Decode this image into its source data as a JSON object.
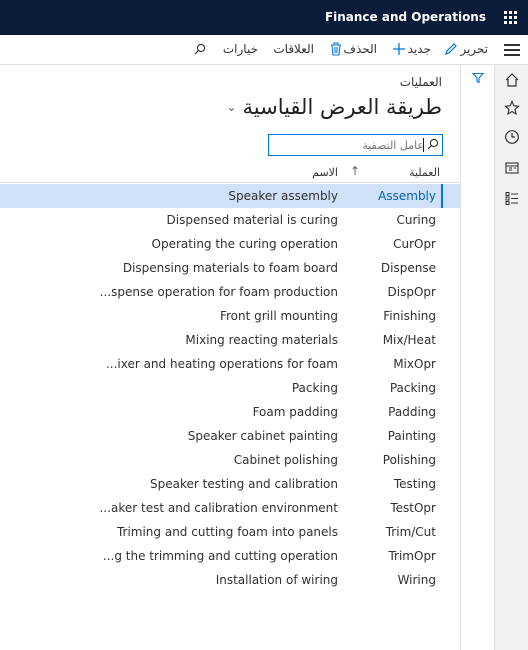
{
  "app": {
    "title": "Finance and Operations"
  },
  "toolbar": {
    "edit_label": "تحرير",
    "new_label": "جديد",
    "delete_label": "الحذف",
    "relations_label": "العلاقات",
    "options_label": "خيارات"
  },
  "page": {
    "caption": "العمليات",
    "view_title": "طريقة العرض القياسية",
    "filter_placeholder": "عامل التصفية"
  },
  "grid": {
    "columns": {
      "operation": "العملية",
      "name": "الاسم"
    },
    "rows": [
      {
        "op": "Assembly",
        "name": "Speaker assembly"
      },
      {
        "op": "Curing",
        "name": "Dispensed material is curing"
      },
      {
        "op": "CurOpr",
        "name": "Operating the curing operation"
      },
      {
        "op": "Dispense",
        "name": "Dispensing materials to foam board"
      },
      {
        "op": "DispOpr",
        "name": "...spense operation for foam production"
      },
      {
        "op": "Finishing",
        "name": "Front grill mounting"
      },
      {
        "op": "Mix/Heat",
        "name": "Mixing reacting materials"
      },
      {
        "op": "MixOpr",
        "name": "...ixer and heating operations for foam"
      },
      {
        "op": "Packing",
        "name": "Packing"
      },
      {
        "op": "Padding",
        "name": "Foam padding"
      },
      {
        "op": "Painting",
        "name": "Speaker cabinet painting"
      },
      {
        "op": "Polishing",
        "name": "Cabinet polishing"
      },
      {
        "op": "Testing",
        "name": "Speaker testing and calibration"
      },
      {
        "op": "TestOpr",
        "name": "...aker test and calibration environment"
      },
      {
        "op": "Trim/Cut",
        "name": "Triming and cutting foam into panels"
      },
      {
        "op": "TrimOpr",
        "name": "...g the trimming and cutting operation"
      },
      {
        "op": "Wiring",
        "name": "Installation of wiring"
      }
    ]
  },
  "colors": {
    "topbar": "#0a1c3a",
    "accent": "#0078d4",
    "selected_row": "#cfe0f7"
  }
}
